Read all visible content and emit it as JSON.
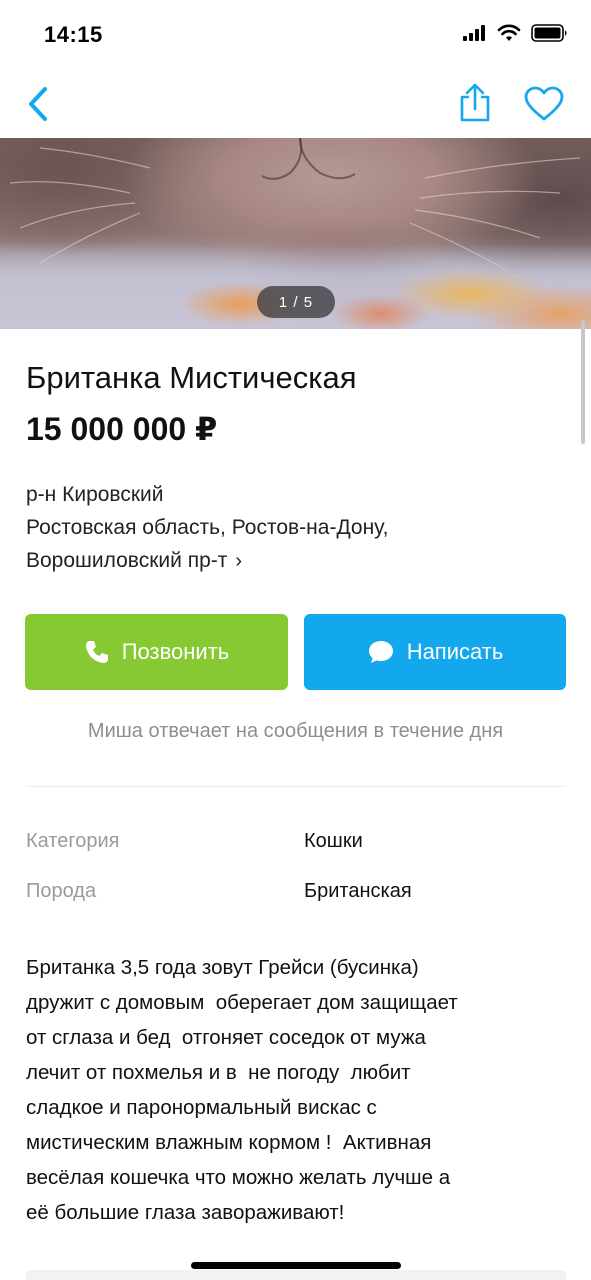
{
  "status_bar": {
    "time": "14:15",
    "icons": [
      "cellular-signal-icon",
      "wifi-icon",
      "battery-icon"
    ]
  },
  "nav": {
    "icons": [
      "chevron-left-icon",
      "share-icon",
      "heart-icon"
    ],
    "accent_color": "#13a7ee"
  },
  "gallery": {
    "counter": "1 / 5"
  },
  "listing": {
    "title": "Британка Мистическая",
    "price": "15 000 000 ₽"
  },
  "address": {
    "line1": "р-н Кировский",
    "line2": "Ростовская область, Ростов-на-Дону,",
    "line3": "Ворошиловский пр-т",
    "chevron": "›"
  },
  "actions": {
    "call_label": "Позвонить",
    "write_label": "Написать",
    "call_color": "#86c932",
    "write_color": "#13a7ee"
  },
  "reply_note": "Миша отвечает на сообщения в течение дня",
  "params": [
    {
      "label": "Категория",
      "value": "Кошки"
    },
    {
      "label": "Порода",
      "value": "Британская"
    }
  ],
  "description": "Британка 3,5 года зовут Грейси (бусинка)\nдружит с домовым  оберегает дом защищает\nот сглаза и бед  отгоняет соседок от мужа\nлечит от похмелья и в  не погоду  любит\nсладкое и паронормальный вискас с\nмистическим влажным кормом !  Активная\nвесёлая кошечка что можно желать лучше а\nеё большие глаза завораживают!"
}
